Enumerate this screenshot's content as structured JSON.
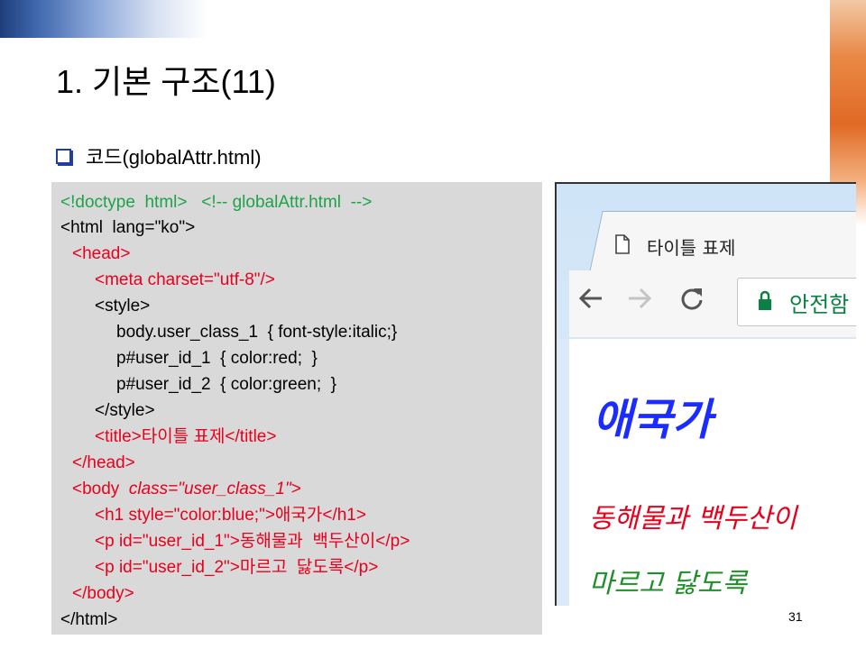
{
  "slide": {
    "title": "1. 기본 구조(11)",
    "bullet": "코드(globalAttr.html)",
    "page_number": "31"
  },
  "code": {
    "l01_a": "<!doctype  html>",
    "l01_b": "   <!-- globalAttr.html  -->",
    "l02": "<html  lang=\"ko\">",
    "l03": "<head>",
    "l04": "<meta charset=\"utf-8\"/>",
    "l05": "<style>",
    "l06": "body.user_class_1  { font-style:italic;}",
    "l07": "p#user_id_1  { color:red;  }",
    "l08": "p#user_id_2  { color:green;  }",
    "l09": "</style>",
    "l10": "<title>타이틀 표제</title>",
    "l11": "</head>",
    "l12_a": "<body  ",
    "l12_b": "class=\"user_class_1\"",
    "l12_c": ">",
    "l13": "<h1 style=\"color:blue;\">애국가</h1>",
    "l14": "<p id=\"user_id_1\">동해물과  백두산이</p>",
    "l15": "<p id=\"user_id_2\">마르고  닳도록</p>",
    "l16": "</body>",
    "l17": "</html>"
  },
  "browser": {
    "tab_title": "타이틀 표제",
    "security_label": "안전함",
    "h1": "애국가",
    "p1": "동해물과 백두산이",
    "p2": "마르고 닳도록"
  },
  "colors": {
    "comment": "#1fa24a",
    "tag": "#e8001c",
    "h1": "#1a2cff",
    "p1": "#e8001c",
    "p2": "#1f8f2a"
  }
}
